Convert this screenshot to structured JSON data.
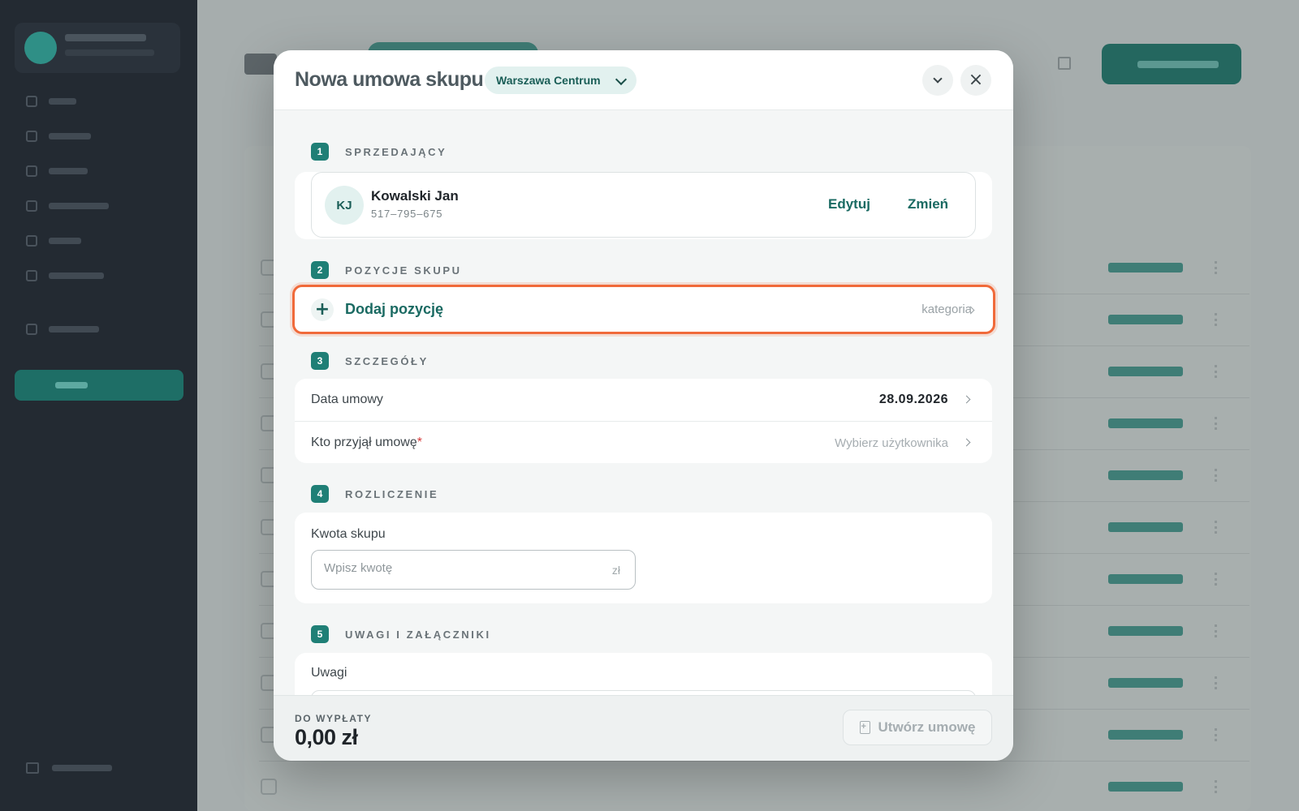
{
  "modal": {
    "title": "Nowa umowa skupu",
    "branch": "Warszawa Centrum",
    "close_symbol": "×"
  },
  "sections": {
    "seller": {
      "number": "1",
      "title": "SPRZEDAJĄCY",
      "initials": "KJ",
      "name": "Kowalski Jan",
      "phone": "517–795–675",
      "edit_label": "Edytuj",
      "change_label": "Zmień"
    },
    "positions": {
      "number": "2",
      "title": "POZYCJE SKUPU",
      "plus_symbol": "+",
      "add_label": "Dodaj pozycję",
      "category_label": "kategoria"
    },
    "details": {
      "number": "3",
      "title": "SZCZEGÓŁY",
      "date_label": "Data umowy",
      "date_value": "28.09.2026",
      "accepted_by_label": "Kto przyjął umowę",
      "required_mark": "*",
      "accepted_by_placeholder": "Wybierz użytkownika"
    },
    "settlement": {
      "number": "4",
      "title": "ROZLICZENIE",
      "amount_label": "Kwota skupu",
      "amount_placeholder": "Wpisz kwotę",
      "amount_unit": "zł"
    },
    "notes": {
      "number": "5",
      "title": "UWAGI I ZAŁĄCZNIKI",
      "notes_label": "Uwagi"
    }
  },
  "footer": {
    "pay_label": "DO WYPŁATY",
    "pay_value": "0,00 zł",
    "create_label": "Utwórz umowę"
  },
  "colors": {
    "accent": "#1f7f76",
    "highlight": "#f06a3a",
    "required": "#d63b3b"
  }
}
